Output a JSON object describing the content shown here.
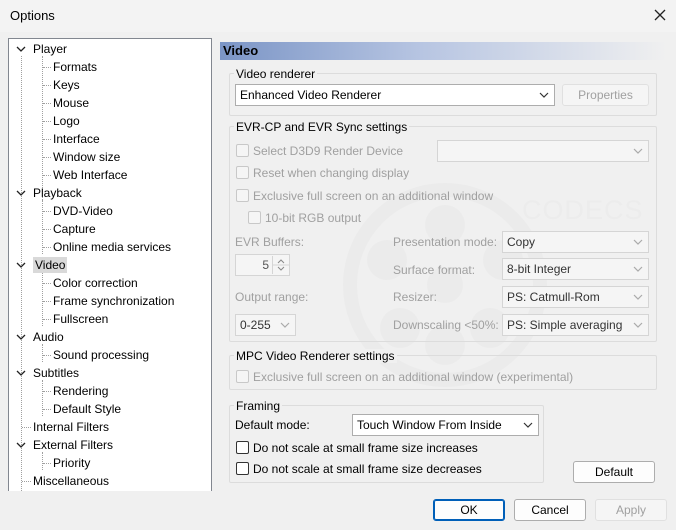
{
  "window": {
    "title": "Options"
  },
  "tree": {
    "items": [
      {
        "label": "Player",
        "level": 0,
        "expanded": true
      },
      {
        "label": "Formats",
        "level": 1
      },
      {
        "label": "Keys",
        "level": 1
      },
      {
        "label": "Mouse",
        "level": 1
      },
      {
        "label": "Logo",
        "level": 1
      },
      {
        "label": "Interface",
        "level": 1
      },
      {
        "label": "Window size",
        "level": 1
      },
      {
        "label": "Web Interface",
        "level": 1
      },
      {
        "label": "Playback",
        "level": 0,
        "expanded": true
      },
      {
        "label": "DVD-Video",
        "level": 1
      },
      {
        "label": "Capture",
        "level": 1
      },
      {
        "label": "Online media services",
        "level": 1
      },
      {
        "label": "Video",
        "level": 0,
        "expanded": true,
        "selected": true
      },
      {
        "label": "Color correction",
        "level": 1
      },
      {
        "label": "Frame synchronization",
        "level": 1
      },
      {
        "label": "Fullscreen",
        "level": 1
      },
      {
        "label": "Audio",
        "level": 0,
        "expanded": true
      },
      {
        "label": "Sound processing",
        "level": 1
      },
      {
        "label": "Subtitles",
        "level": 0,
        "expanded": true
      },
      {
        "label": "Rendering",
        "level": 1
      },
      {
        "label": "Default Style",
        "level": 1
      },
      {
        "label": "Internal Filters",
        "level": 0
      },
      {
        "label": "External Filters",
        "level": 0,
        "expanded": true
      },
      {
        "label": "Priority",
        "level": 1
      },
      {
        "label": "Miscellaneous",
        "level": 0
      }
    ]
  },
  "page": {
    "title": "Video",
    "renderer": {
      "group_label": "Video renderer",
      "selected": "Enhanced Video Renderer",
      "properties_label": "Properties"
    },
    "evr": {
      "group_label": "EVR-CP and EVR Sync settings",
      "select_d3d9": "Select D3D9 Render Device",
      "d3d9_device": "",
      "reset_on_change": "Reset when changing display",
      "exclusive_fullscreen": "Exclusive full screen on an additional window",
      "rgb10": "10-bit RGB output",
      "buffers_label": "EVR Buffers:",
      "buffers_value": "5",
      "output_range_label": "Output range:",
      "output_range_value": "0-255",
      "presentation_label": "Presentation mode:",
      "presentation_value": "Copy",
      "surface_label": "Surface format:",
      "surface_value": "8-bit Integer",
      "resizer_label": "Resizer:",
      "resizer_value": "PS: Catmull-Rom",
      "downscaling_label": "Downscaling <50%:",
      "downscaling_value": "PS: Simple averaging"
    },
    "mpc": {
      "group_label": "MPC Video Renderer settings",
      "exclusive_fullscreen": "Exclusive full screen on an additional window (experimental)"
    },
    "framing": {
      "group_label": "Framing",
      "default_mode_label": "Default mode:",
      "default_mode_value": "Touch Window From Inside",
      "no_scale_increase": "Do not scale at small frame size increases",
      "no_scale_decrease": "Do not scale at small frame size decreases"
    },
    "default_button": "Default"
  },
  "watermark": {
    "text": "CODECS"
  },
  "footer": {
    "ok": "OK",
    "cancel": "Cancel",
    "apply": "Apply"
  }
}
